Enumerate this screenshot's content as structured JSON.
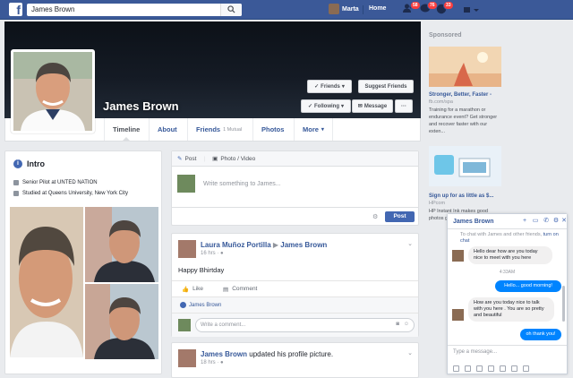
{
  "topbar": {
    "search_value": "James Brown",
    "user_name": "Marta",
    "home": "Home",
    "friend_requests_count": "58",
    "messages_count": "76",
    "notifications_count": "33",
    "brand_color": "#3b5998"
  },
  "profile": {
    "name": "James Brown",
    "friends_btn": "Friends",
    "suggest_btn": "Suggest Friends",
    "following_btn": "Following",
    "message_btn": "Message",
    "more_btn": "···"
  },
  "tabs": {
    "timeline": "Timeline",
    "about": "About",
    "friends": "Friends",
    "friends_mutual": "1 Mutual",
    "photos": "Photos",
    "more": "More"
  },
  "intro": {
    "title": "Intro",
    "work": "Senior Pilot at UNTED NATION",
    "education": "Studied at Queens University, New York City"
  },
  "composer": {
    "tab_post": "Post",
    "tab_photo": "Photo / Video",
    "placeholder": "Write something to James...",
    "post_btn": "Post"
  },
  "post1": {
    "author": "Laura Muñoz Portilla",
    "target": "James Brown",
    "time": "16 hrs",
    "body": "Happy Bhirtday",
    "like": "Like",
    "comment": "Comment",
    "likes": "James Brown",
    "comment_placeholder": "Write a comment..."
  },
  "post2": {
    "author": "James Brown",
    "action": "updated his profile picture.",
    "time": "18 hrs"
  },
  "rail": {
    "sponsored": "Sponsored",
    "ad1_title": "Stronger, Better, Faster -",
    "ad1_url": "fb.com/spa",
    "ad1_desc": "Training for a marathon or endurance event? Get stronger and recover faster with our exten...",
    "ad2_title": "Sign up for as little as $...",
    "ad2_url": "HPcom",
    "ad2_desc": "HP Instant Ink makes good photos g..."
  },
  "chat": {
    "name": "James Brown",
    "note": "To chat with James and other friends,",
    "note_link": "turn on chat",
    "msg1": "Hello dear how are you today nice to meet with you here",
    "time": "4:33AM",
    "msg2": "Hello... good morning!",
    "msg3": "How are you today nice to talk with you here . You are so pretty and beautiful",
    "msg4": "oh thank you!",
    "input_placeholder": "Type a message..."
  }
}
